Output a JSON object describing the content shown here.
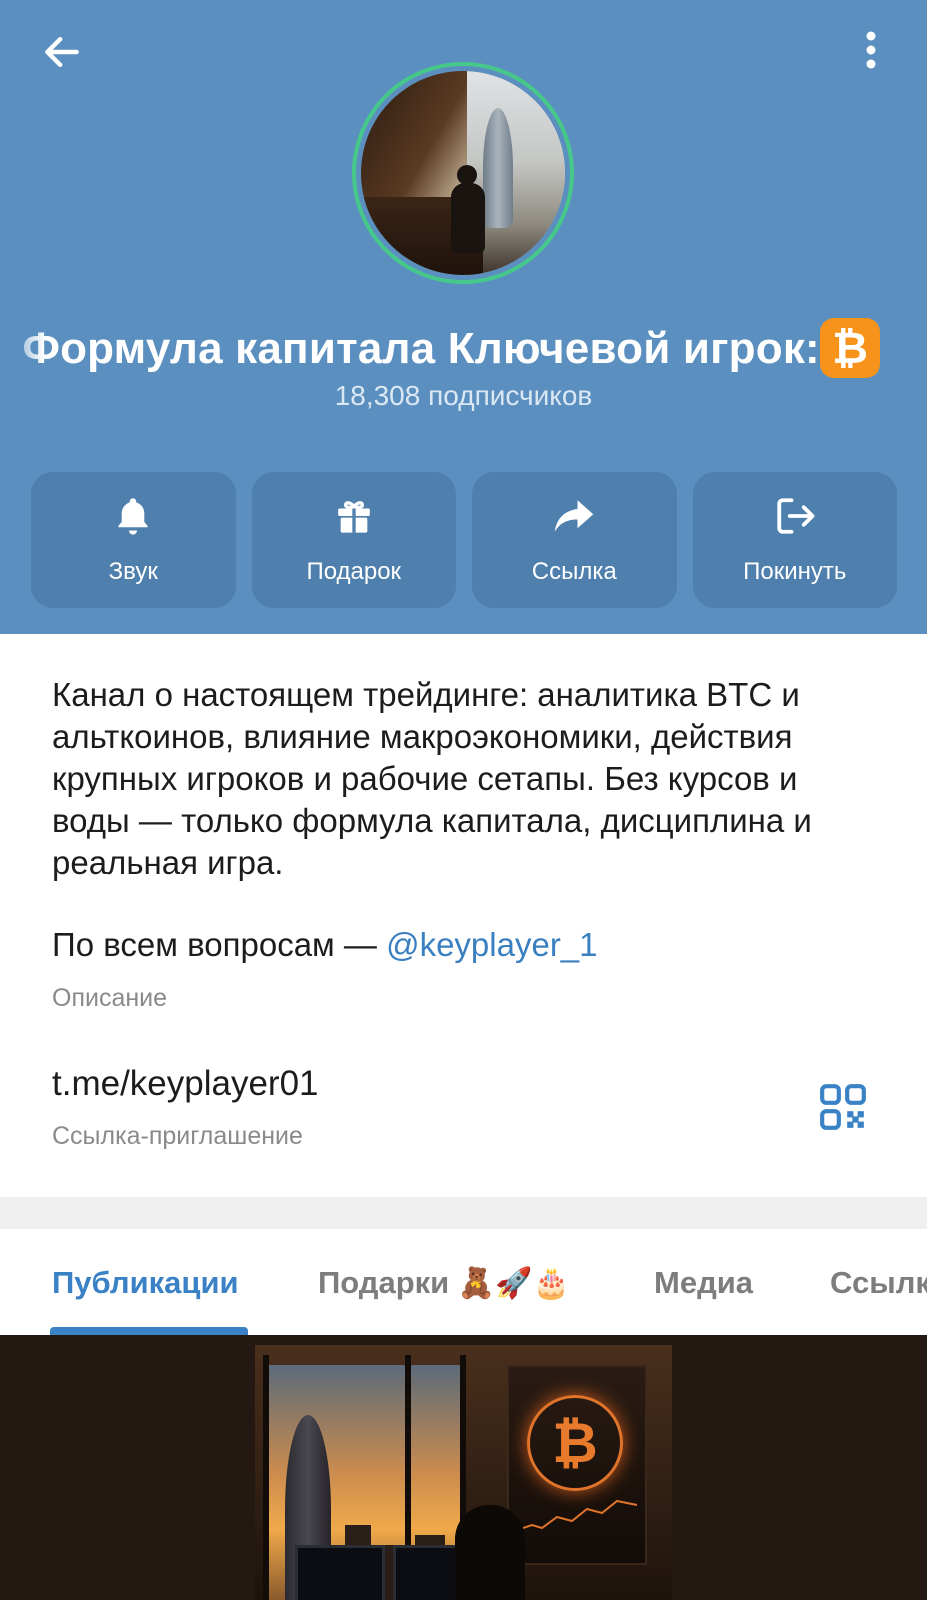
{
  "header": {
    "title": "Формула капитала    Ключевой игрок: с",
    "title_badge_icon": "bitcoin-icon",
    "subscribers": "18,308 подписчиков",
    "bg_color": "#5b8fbf",
    "avatar_ring_color": "#46c88a"
  },
  "actions": [
    {
      "label": "Звук",
      "icon": "bell-icon"
    },
    {
      "label": "Подарок",
      "icon": "gift-icon"
    },
    {
      "label": "Ссылка",
      "icon": "share-icon"
    },
    {
      "label": "Покинуть",
      "icon": "leave-icon"
    }
  ],
  "info": {
    "description": "Канал о настоящем трейдинге: аналитика BTC и альткоинов, влияние макроэкономики, действия крупных игроков и рабочие сетапы. Без курсов и воды — только формула капитала, дисциплина и реальная игра.",
    "contact_prefix": "По всем вопросам — ",
    "contact_mention": "@keyplayer_1",
    "description_caption": "Описание",
    "invite_link": "t.me/keyplayer01",
    "invite_caption": "Ссылка-приглашение"
  },
  "tabs": [
    {
      "label": "Публикации",
      "active": true
    },
    {
      "label": "Подарки",
      "emojis": "🧸🚀🎂",
      "active": false
    },
    {
      "label": "Медиа",
      "active": false
    },
    {
      "label": "Ссылки",
      "active": false
    }
  ],
  "colors": {
    "accent": "#3a82c5",
    "mention": "#3a7fc0",
    "btc_badge": "#f7931a"
  }
}
